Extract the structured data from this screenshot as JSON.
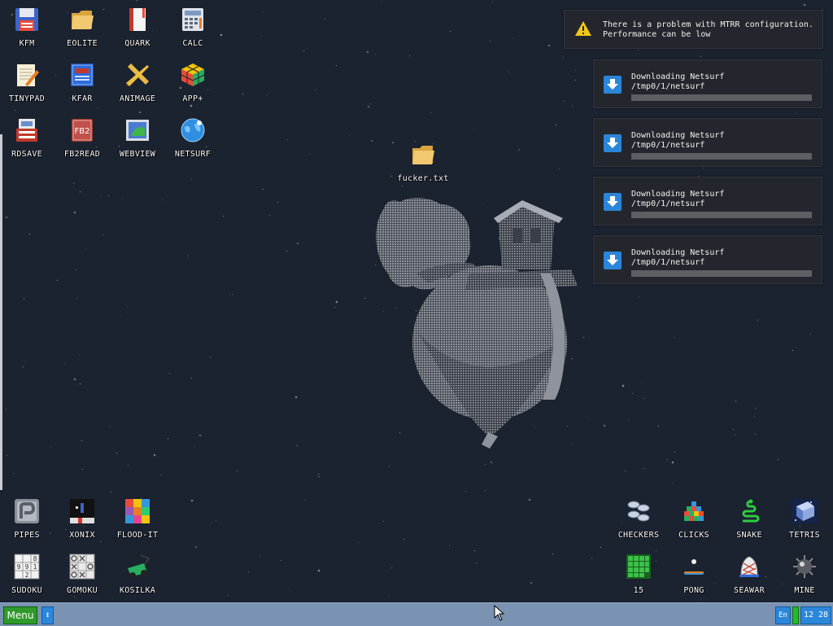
{
  "desktop": {
    "top_icons": [
      {
        "label": "KFM",
        "icon": "floppy-icon"
      },
      {
        "label": "EOLITE",
        "icon": "folder-icon"
      },
      {
        "label": "QUARK",
        "icon": "notebook-icon"
      },
      {
        "label": "CALC",
        "icon": "calculator-icon"
      },
      {
        "label": "TINYPAD",
        "icon": "notepad-icon"
      },
      {
        "label": "KFAR",
        "icon": "kfar-icon"
      },
      {
        "label": "ANIMAGE",
        "icon": "pencil-ruler-icon"
      },
      {
        "label": "APP+",
        "icon": "rubik-cube-icon"
      },
      {
        "label": "RDSAVE",
        "icon": "rdsave-icon"
      },
      {
        "label": "FB2READ",
        "icon": "book-icon"
      },
      {
        "label": "WEBVIEW",
        "icon": "webview-icon"
      },
      {
        "label": "NETSURF",
        "icon": "globe-icon"
      }
    ],
    "file_icon": {
      "label": "fucker.txt",
      "icon": "folder-icon"
    },
    "bottom_left_icons": [
      {
        "label": "PIPES",
        "icon": "pipes-icon"
      },
      {
        "label": "XONIX",
        "icon": "xonix-icon"
      },
      {
        "label": "FLOOD-IT",
        "icon": "flood-it-icon"
      },
      {
        "label": "SUDOKU",
        "icon": "sudoku-icon"
      },
      {
        "label": "GOMOKU",
        "icon": "gomoku-icon"
      },
      {
        "label": "KOSILKA",
        "icon": "lawnmower-icon"
      }
    ],
    "bottom_right_icons": [
      {
        "label": "CHECKERS",
        "icon": "checkers-icon"
      },
      {
        "label": "CLICKS",
        "icon": "clicks-icon"
      },
      {
        "label": "SNAKE",
        "icon": "snake-icon"
      },
      {
        "label": "TETRIS",
        "icon": "tetris-icon"
      },
      {
        "label": "15",
        "icon": "fifteen-puzzle-icon"
      },
      {
        "label": "PONG",
        "icon": "pong-icon"
      },
      {
        "label": "SEAWAR",
        "icon": "seawar-icon"
      },
      {
        "label": "MINE",
        "icon": "mine-icon"
      }
    ]
  },
  "notifications": {
    "warning": {
      "line1": "There is a problem with MTRR configuration.",
      "line2": "Performance can be low",
      "icon": "warning-icon",
      "color": "#f2c618"
    },
    "downloads": [
      {
        "title": "Downloading Netsurf",
        "path": "/tmp0/1/netsurf",
        "progress": 0,
        "icon": "download-icon"
      },
      {
        "title": "Downloading Netsurf",
        "path": "/tmp0/1/netsurf",
        "progress": 0,
        "icon": "download-icon"
      },
      {
        "title": "Downloading Netsurf",
        "path": "/tmp0/1/netsurf",
        "progress": 0,
        "icon": "download-icon"
      },
      {
        "title": "Downloading Netsurf",
        "path": "/tmp0/1/netsurf",
        "progress": 0,
        "icon": "download-icon"
      }
    ]
  },
  "taskbar": {
    "menu_label": "Menu",
    "swap_label": "↕",
    "language": "En",
    "clock": "12 28"
  },
  "colors": {
    "desktop_bg": "#1b2230",
    "taskbar_bg": "#7a93b3",
    "accent_blue": "#2b87da",
    "menu_green": "#2f9a2a"
  }
}
